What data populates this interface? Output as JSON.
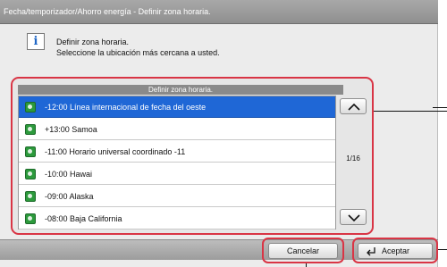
{
  "window": {
    "title": "Fecha/temporizador/Ahorro energía - Definir zona horaria."
  },
  "message": {
    "icon": "info-icon",
    "line1": "Definir zona horaria.",
    "line2": "Seleccione la ubicación más cercana a usted."
  },
  "list": {
    "header": "Definir zona horaria.",
    "items": [
      {
        "label": "-12:00 Línea internacional de fecha del oeste",
        "selected": true,
        "icon": "globe-icon"
      },
      {
        "label": "+13:00 Samoa",
        "selected": false,
        "icon": "globe-icon"
      },
      {
        "label": "-11:00 Horario universal coordinado -11",
        "selected": false,
        "icon": "globe-icon"
      },
      {
        "label": "-10:00 Hawai",
        "selected": false,
        "icon": "globe-icon"
      },
      {
        "label": "-09:00 Alaska",
        "selected": false,
        "icon": "globe-icon"
      },
      {
        "label": "-08:00 Baja California",
        "selected": false,
        "icon": "globe-icon"
      }
    ],
    "page_indicator": "1/16",
    "scroll_up_icon": "chevron-up-icon",
    "scroll_down_icon": "chevron-down-icon"
  },
  "footer": {
    "cancel_label": "Cancelar",
    "accept_label": "Aceptar",
    "accept_icon": "enter-icon"
  },
  "colors": {
    "selection": "#1f67d6",
    "highlight_frame": "#d93545",
    "title_bar": "#9a9a9a"
  }
}
